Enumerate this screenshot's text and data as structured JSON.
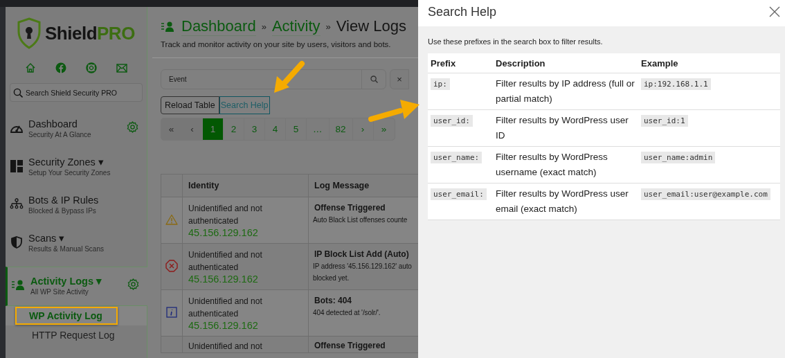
{
  "sidebar": {
    "logo": {
      "name": "Shield",
      "suffix": "PRO"
    },
    "search": {
      "placeholder": "Search Shield Security PRO"
    },
    "nav": [
      {
        "title": "Dashboard",
        "subtitle": "Security At A Glance",
        "settings": true,
        "selected": false
      },
      {
        "title": "Security Zones",
        "menu_marker": "▾",
        "subtitle": "Setup Your Security Zones",
        "settings": false,
        "selected": false
      },
      {
        "title": "Bots & IP Rules",
        "subtitle": "Blocked & Bypass IPs",
        "settings": false,
        "selected": false
      },
      {
        "title": "Scans",
        "menu_marker": "▾",
        "subtitle": "Results & Manual Scans",
        "settings": false,
        "selected": false
      },
      {
        "title": "Activity Logs",
        "menu_marker": "▾",
        "subtitle": "All WP Site Activity",
        "settings": true,
        "selected": true
      }
    ],
    "submenu": [
      {
        "label": "WP Activity Log",
        "selected": true,
        "highlighted": true
      },
      {
        "label": "HTTP Request Log",
        "selected": false,
        "highlighted": false
      }
    ]
  },
  "header": {
    "breadcrumbs": [
      {
        "label": "Dashboard",
        "link": true
      },
      {
        "label": "Activity",
        "link": true
      },
      {
        "label": "View Logs",
        "link": false
      }
    ],
    "separators": [
      "»",
      "»"
    ],
    "description": "Track and monitor activity on your site by users, visitors and bots."
  },
  "search_field": {
    "value": "Event"
  },
  "clear_button": "×",
  "buttons": [
    {
      "label": "Reload Table",
      "kind": "outline",
      "highlighted": false
    },
    {
      "label": "Search Help",
      "kind": "link",
      "highlighted": true
    }
  ],
  "pagination": [
    {
      "label": "«",
      "selected": false,
      "disabled": true
    },
    {
      "label": "‹",
      "selected": false,
      "disabled": true
    },
    {
      "label": "1",
      "selected": true,
      "disabled": false
    },
    {
      "label": "2",
      "selected": false,
      "disabled": false
    },
    {
      "label": "3",
      "selected": false,
      "disabled": false
    },
    {
      "label": "4",
      "selected": false,
      "disabled": false
    },
    {
      "label": "5",
      "selected": false,
      "disabled": false
    },
    {
      "label": "…",
      "selected": false,
      "disabled": false
    },
    {
      "label": "82",
      "selected": false,
      "disabled": false
    },
    {
      "label": "›",
      "selected": false,
      "disabled": false
    },
    {
      "label": "»",
      "selected": false,
      "disabled": false
    }
  ],
  "table": {
    "columns": [
      "Identity",
      "Log Message"
    ],
    "rows": [
      {
        "kind": "warning",
        "identity": "Unidentified and not authenticated",
        "ip": "45.156.129.162",
        "title": "Offense Triggered",
        "message_lines": [
          "Auto Black List offenses counte"
        ]
      },
      {
        "kind": "error",
        "identity": "Unidentified and not authenticated",
        "ip": "45.156.129.162",
        "title": "IP Block List Add (Auto)",
        "message_lines": [
          "IP address '45.156.129.162' auto",
          "blocked yet."
        ]
      },
      {
        "kind": "info",
        "identity": "Unidentified and not authenticated",
        "ip": "45.156.129.162",
        "title": "Bots: 404",
        "message_lines": [
          "404 detected at '/solr/'."
        ]
      },
      {
        "identity": "Unidentified and not",
        "title": "Offense Triggered"
      }
    ]
  },
  "modal": {
    "title": "Search Help",
    "intro": "Use these prefixes in the search box to filter results.",
    "columns": [
      "Prefix",
      "Description",
      "Example"
    ],
    "rows": [
      {
        "prefix": "ip:",
        "description": "Filter results by IP address (full or partial match)",
        "example": "ip:192.168.1.1"
      },
      {
        "prefix": "user_id:",
        "description": "Filter results by WordPress user ID",
        "example": "user_id:1"
      },
      {
        "prefix": "user_name:",
        "description": "Filter results by WordPress username (exact match)",
        "example": "user_name:admin"
      },
      {
        "prefix": "user_email:",
        "description": "Filter results by WordPress user email (exact match)",
        "example": "user_email:user@example.com"
      }
    ]
  }
}
